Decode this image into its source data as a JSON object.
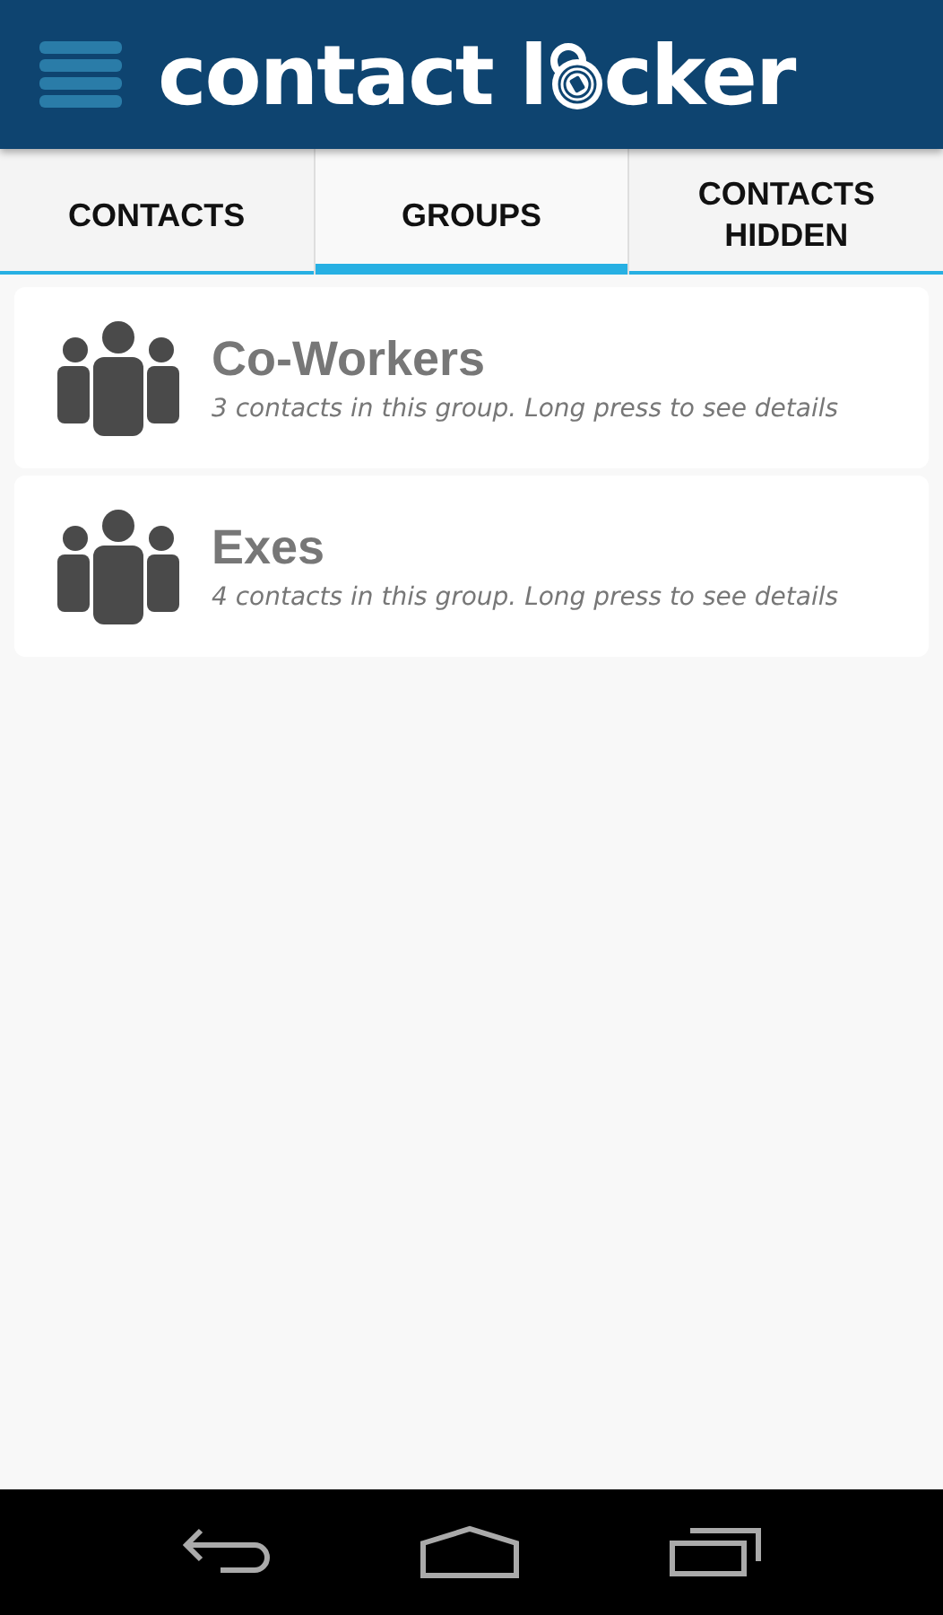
{
  "app_bar": {
    "logo_start": "contact l",
    "logo_end": "cker"
  },
  "tabs": [
    {
      "label": "CONTACTS",
      "selected": false
    },
    {
      "label": "GROUPS",
      "selected": true
    },
    {
      "label": "CONTACTS HIDDEN",
      "selected": false
    }
  ],
  "groups": [
    {
      "name": "Co-Workers",
      "description": "3 contacts in this group. Long press to see details"
    },
    {
      "name": "Exes",
      "description": "4 contacts in this group. Long press to see details"
    }
  ]
}
